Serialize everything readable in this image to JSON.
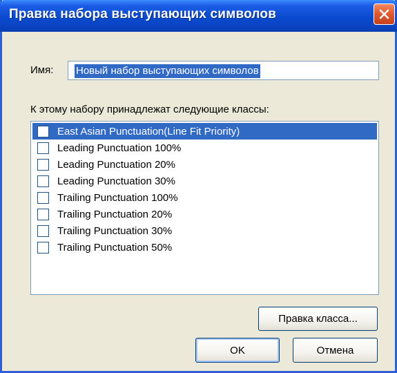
{
  "window": {
    "title": "Правка набора выступающих символов",
    "close_icon": "close-x-icon"
  },
  "name_field": {
    "label": "Имя:",
    "value": "Новый набор выступающих символов"
  },
  "classes": {
    "label": "К этому набору принадлежат следующие классы:",
    "items": [
      {
        "label": "East Asian Punctuation(Line Fit Priority)",
        "checked": false,
        "selected": true
      },
      {
        "label": "Leading Punctuation 100%",
        "checked": false,
        "selected": false
      },
      {
        "label": "Leading Punctuation 20%",
        "checked": false,
        "selected": false
      },
      {
        "label": "Leading Punctuation 30%",
        "checked": false,
        "selected": false
      },
      {
        "label": "Trailing Punctuation 100%",
        "checked": false,
        "selected": false
      },
      {
        "label": "Trailing Punctuation 20%",
        "checked": false,
        "selected": false
      },
      {
        "label": "Trailing Punctuation 30%",
        "checked": false,
        "selected": false
      },
      {
        "label": "Trailing Punctuation 50%",
        "checked": false,
        "selected": false
      }
    ]
  },
  "buttons": {
    "edit_class": "Правка класса...",
    "ok": "OK",
    "cancel": "Отмена"
  },
  "colors": {
    "titlebar": "#0a4ad0",
    "selection": "#316ac5",
    "dialog_bg": "#ece9d8",
    "close_button": "#e35a2e"
  }
}
